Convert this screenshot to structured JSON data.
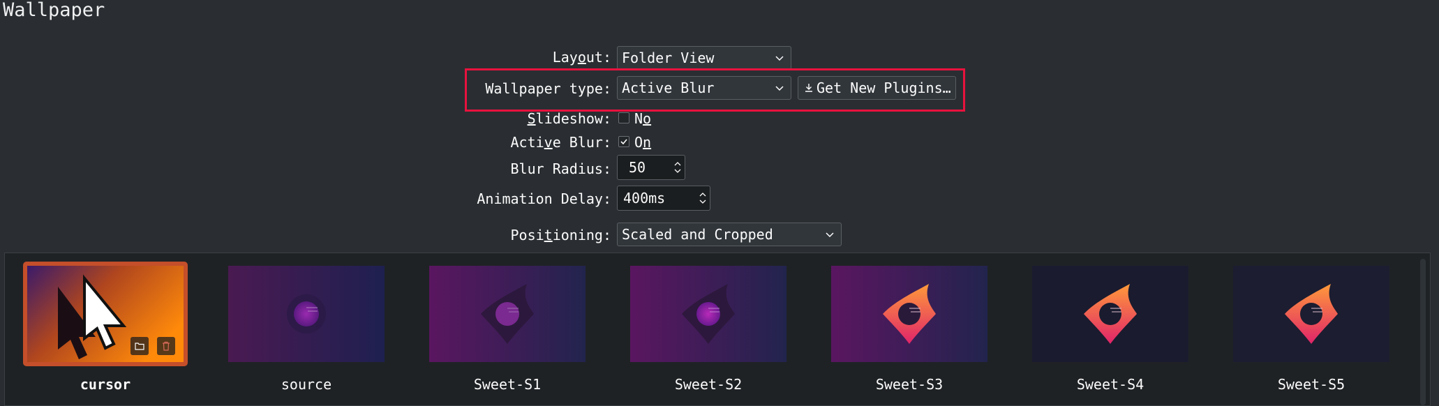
{
  "page": {
    "title": "Wallpaper"
  },
  "form": {
    "layout": {
      "label_pre": "Lay",
      "label_u": "o",
      "label_post": "ut:",
      "value": "Folder View"
    },
    "wallpaper_type": {
      "label": "Wallpaper type:",
      "value": "Active Blur",
      "get_plugins_label": "Get New Plugins…"
    },
    "slideshow": {
      "label_u": "S",
      "label_post": "lideshow:",
      "checked": false,
      "state_pre": "N",
      "state_u": "o"
    },
    "active_blur": {
      "label_pre": "Acti",
      "label_u": "v",
      "label_post": "e Blur:",
      "checked": true,
      "state_pre": "O",
      "state_u": "n"
    },
    "blur_radius": {
      "label": "Blur Radius:",
      "value": "50"
    },
    "animation_delay": {
      "label": "Animation Delay:",
      "value": "400ms"
    },
    "positioning": {
      "label_pre": "Posi",
      "label_u": "t",
      "label_post": "ioning:",
      "value": "Scaled and Cropped"
    }
  },
  "gallery": {
    "items": [
      {
        "name": "cursor",
        "selected": true
      },
      {
        "name": "source",
        "selected": false
      },
      {
        "name": "Sweet-S1",
        "selected": false
      },
      {
        "name": "Sweet-S2",
        "selected": false
      },
      {
        "name": "Sweet-S3",
        "selected": false
      },
      {
        "name": "Sweet-S4",
        "selected": false
      },
      {
        "name": "Sweet-S5",
        "selected": false
      }
    ]
  },
  "colors": {
    "background": "#2a2e32",
    "highlight": "#e8123e",
    "selection": "#c44f2a",
    "check": "#fcfcfc"
  },
  "icons": {
    "combo": "chevron-down-icon",
    "plugins": "download-icon",
    "spin": "spin-arrows-icon",
    "open_folder": "folder-icon",
    "delete": "trash-icon"
  }
}
